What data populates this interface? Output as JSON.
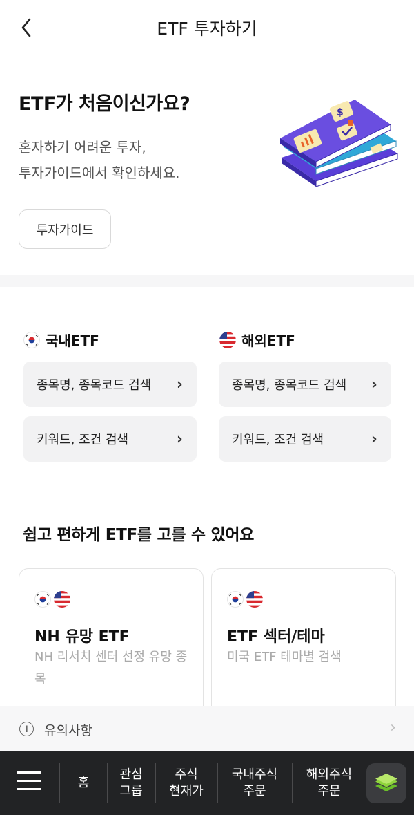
{
  "header": {
    "title": "ETF 투자하기",
    "back_icon": "chevron-left-icon"
  },
  "intro": {
    "title": "ETF가 처음이신가요?",
    "desc_line1": "혼자하기 어려운 투자,",
    "desc_line2": "투자가이드에서 확인하세요.",
    "guide_button": "투자가이드",
    "illustration": "books-illustration"
  },
  "domestic": {
    "label": "국내ETF",
    "flag_icon": "korea-flag-icon",
    "search_name": "종목명, 종목코드 검색",
    "search_keyword": "키워드, 조건 검색"
  },
  "overseas": {
    "label": "해외ETF",
    "flag_icon": "usa-flag-icon",
    "search_name": "종목명, 종목코드 검색",
    "search_keyword": "키워드, 조건 검색"
  },
  "section2": {
    "title": "쉽고 편하게 ETF를 고를 수 있어요",
    "cards": [
      {
        "title": "NH 유망 ETF",
        "desc": "NH 리서치 센터 선정 유망 종목"
      },
      {
        "title": "ETF 섹터/테마",
        "desc": "미국 ETF 테마별 검색"
      }
    ]
  },
  "notice": {
    "label": "유의사항"
  },
  "bottom_nav": {
    "items": [
      "홈",
      "관심\n그룹",
      "주식\n현재가",
      "국내주식\n주문",
      "해외주식\n주문"
    ]
  },
  "colors": {
    "accent_purple": "#6a4ee0",
    "nav_bg": "#222325",
    "button_bg": "#f2f2f3"
  }
}
